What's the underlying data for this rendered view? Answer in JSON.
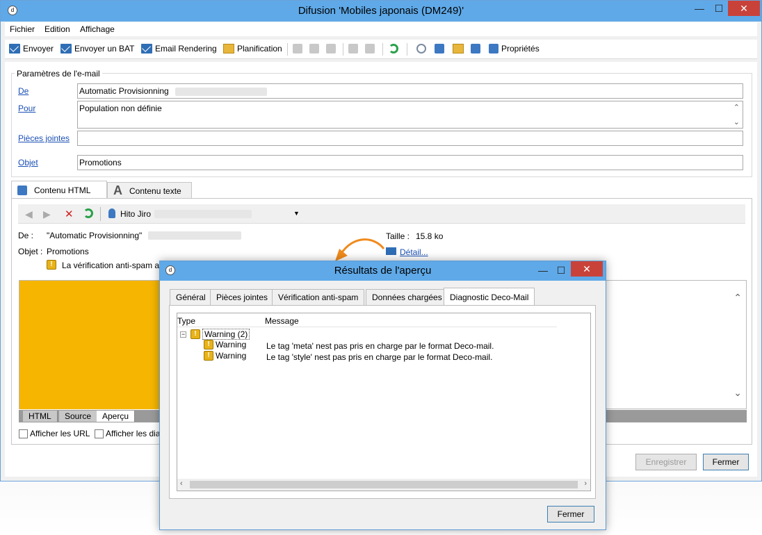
{
  "window": {
    "title": "Difusion 'Mobiles japonais (DM249)'",
    "minimize": "—",
    "maximize": "☐",
    "close": "✕"
  },
  "menu": [
    "Fichier",
    "Edition",
    "Affichage"
  ],
  "toolbar": {
    "envoyer": "Envoyer",
    "envoyer_bat": "Envoyer un BAT",
    "email_rendering": "Email Rendering",
    "planification": "Planification",
    "proprietes": "Propriétés"
  },
  "email_params": {
    "group_label": "Paramètres de l'e-mail",
    "de_label": "De",
    "de_value": "Automatic Provisionning",
    "pour_label": "Pour",
    "pour_value": "Population non définie",
    "pieces_label": "Pièces jointes",
    "pieces_value": "",
    "objet_label": "Objet",
    "objet_value": "Promotions"
  },
  "content_tabs": {
    "html": "Contenu HTML",
    "text": "Contenu texte"
  },
  "preview": {
    "recipient": "Hito Jiro",
    "de_label": "De :",
    "de_value": "\"Automatic Provisionning\"",
    "objet_label": "Objet :",
    "objet_value": "Promotions",
    "taille_label": "Taille :",
    "taille_value": "15.8 ko",
    "detail_link": "Détail...",
    "antispam_text": "La vérification anti-spam a"
  },
  "bottom_tabs": [
    "HTML",
    "Source",
    "Aperçu"
  ],
  "checkboxes": {
    "urls": "Afficher les URL",
    "diag": "Afficher les dia"
  },
  "buttons": {
    "enregistrer": "Enregistrer",
    "fermer": "Fermer"
  },
  "dialog": {
    "title": "Résultats de l'aperçu",
    "tabs": [
      "Général",
      "Pièces jointes",
      "Vérification anti-spam",
      "Données chargées",
      "Diagnostic Deco-Mail"
    ],
    "col_type": "Type",
    "col_message": "Message",
    "group_label": "Warning (2)",
    "rows": [
      {
        "type": "Warning",
        "message": "Le tag 'meta' nest pas pris en charge par le format Deco-mail."
      },
      {
        "type": "Warning",
        "message": "Le tag 'style' nest pas pris en charge par le format Deco-mail."
      }
    ],
    "close_button": "Fermer",
    "minimize": "—",
    "maximize": "☐",
    "close": "✕"
  },
  "colors": {
    "titlebar": "#5fa9e8",
    "accent_orange": "#f5b500",
    "link": "#1a4fb4",
    "close_red": "#c9423a"
  }
}
